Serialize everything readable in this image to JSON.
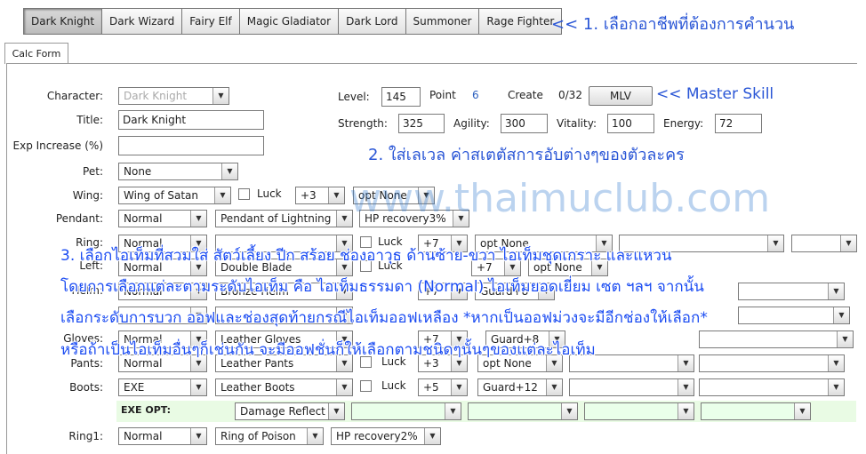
{
  "class_tabs": [
    "Dark Knight",
    "Dark Wizard",
    "Fairy Elf",
    "Magic Gladiator",
    "Dark Lord",
    "Summoner",
    "Rage Fighter"
  ],
  "selected_class": "Dark Knight",
  "form_tab": "Calc Form",
  "labels": {
    "character": "Character:",
    "title": "Title:",
    "exp_increase": "Exp Increase (%)",
    "pet": "Pet:",
    "wing": "Wing:",
    "pendant": "Pendant:",
    "ring": "Ring:",
    "left": "Left:",
    "helm": "Helm:",
    "gloves": "Gloves:",
    "pants": "Pants:",
    "boots": "Boots:",
    "exe_opt": "EXE OPT:",
    "ring1": "Ring1:",
    "level": "Level:",
    "point": "Point",
    "create": "Create",
    "strength": "Strength:",
    "agility": "Agility:",
    "vitality": "Vitality:",
    "energy": "Energy:",
    "luck": "Luck"
  },
  "values": {
    "character": "Dark Knight",
    "title": "Dark Knight",
    "exp_increase": "",
    "pet": "None",
    "level": "145",
    "point": "6",
    "create": "0/32",
    "strength": "325",
    "agility": "300",
    "vitality": "100",
    "energy": "72"
  },
  "mlv_button": "MLV",
  "rows": {
    "wing": {
      "item": "Wing of Satan",
      "plus": "+3",
      "opt": "opt None"
    },
    "pendant": {
      "type": "Normal",
      "item": "Pendant of Lightning",
      "opt": "HP recovery3%"
    },
    "ring": {
      "type": "Normal",
      "item": "",
      "plus": "+7",
      "opt": "opt None"
    },
    "left": {
      "type": "Normal",
      "item": "Double Blade",
      "plus": "+7",
      "opt": "opt None"
    },
    "helm": {
      "type": "Normal",
      "item": "Bronze Helm",
      "plus": "+7",
      "opt": "Guard+8"
    },
    "gloves": {
      "type": "Normal",
      "item": "Leather Gloves",
      "plus": "+7",
      "opt": "Guard+8"
    },
    "pants": {
      "type": "Normal",
      "item": "Leather Pants",
      "plus": "+3",
      "opt": "opt None"
    },
    "boots": {
      "type": "EXE",
      "item": "Leather Boots",
      "plus": "+5",
      "opt": "Guard+12"
    },
    "exe": {
      "opt1": "Damage Reflect"
    },
    "ring1": {
      "type": "Normal",
      "item": "Ring of Poison",
      "opt": "HP recovery2%"
    }
  },
  "annotations": {
    "step1": "<< 1. เลือกอาชีพที่ต้องการคำนวน",
    "master": "<< Master Skill",
    "step2": "2. ใส่เลเวล ค่าสเตตัสการอับต่างๆของตัวละคร",
    "step3_line1": "3. เลือกไอเท็มที่สวมใส่ สัตว์เลี้ยง ปีก สร้อย ช่องอาวุธ ด้านซ้าย-ขวา ไอเท็มชุดเกราะ และแหวน",
    "step3_line2": "โดยการเลือกแต่ละตามระดับไอเท็ม คือ ไอเท็มธรรมดา (Normal) ไอเท็มยอดเยี่ยม เซต ฯลฯ  จากนั้น",
    "step3_line3": "เลือกระดับการบวก ออฟและช่องสุดท้ายกรณีไอเท็มออฟเหลือง  *หากเป็นออฟม่วงจะมีอีกช่องให้เลือก*",
    "step3_line4": "หรือถ้าเป็นไอเท็มอื่นๆก็เช่นกัน จะมีออฟชั่นก็ให้เลือกตามชนิดๆนั้นๆของแต่ละไอเท็ม"
  },
  "watermark": "www.thaimuclub.com",
  "colors": {
    "annotation": "#1b4cf2",
    "exe_row": "#e9fbe4"
  }
}
